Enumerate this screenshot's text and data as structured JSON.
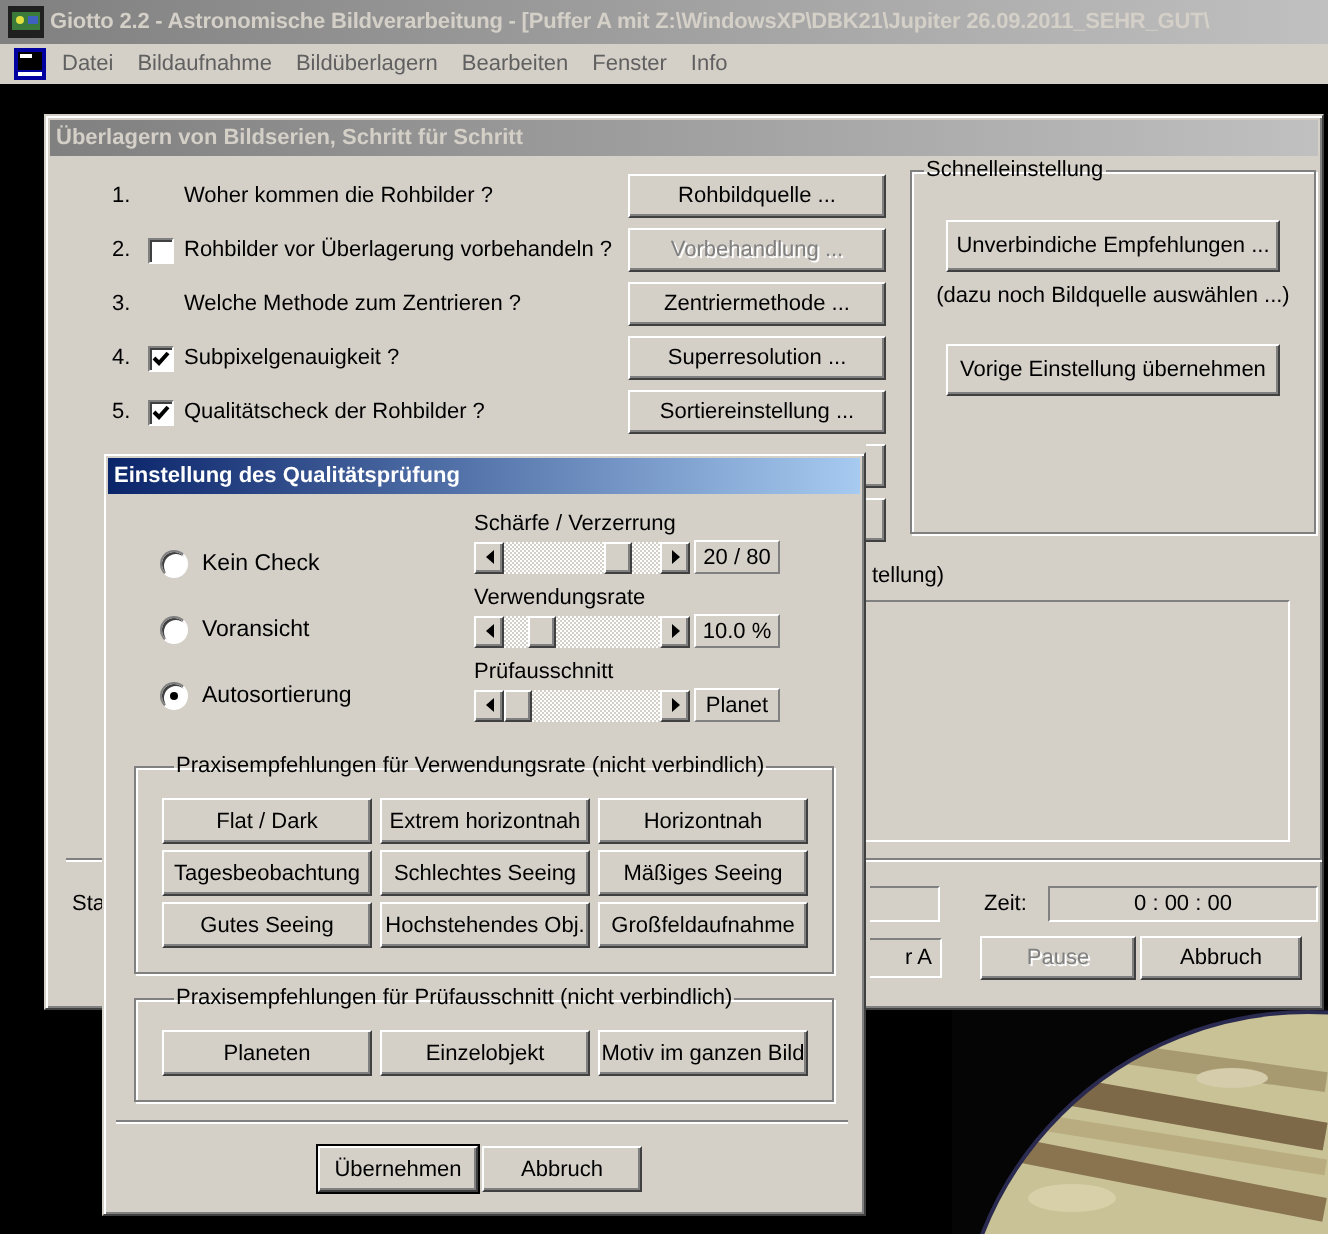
{
  "window": {
    "title": "Giotto 2.2 - Astronomische Bildverarbeitung - [Puffer A mit Z:\\WindowsXP\\DBK21\\Jupiter 26.09.2011_SEHR_GUT\\",
    "menu": [
      "Datei",
      "Bildaufnahme",
      "Bildüberlagern",
      "Bearbeiten",
      "Fenster",
      "Info"
    ]
  },
  "main_dialog": {
    "title": "Überlagern von Bildserien, Schritt für Schritt",
    "steps": [
      {
        "number": "1.",
        "kind": "text",
        "label": "Woher kommen die Rohbilder ?",
        "button": {
          "label": "Rohbildquelle ...",
          "disabled": false
        }
      },
      {
        "number": "2.",
        "kind": "checkbox",
        "checked": false,
        "label": "Rohbilder vor Überlagerung vorbehandeln ?",
        "button": {
          "label": "Vorbehandlung ...",
          "disabled": true
        }
      },
      {
        "number": "3.",
        "kind": "text",
        "label": "Welche Methode zum Zentrieren ?",
        "button": {
          "label": "Zentriermethode ...",
          "disabled": false
        }
      },
      {
        "number": "4.",
        "kind": "checkbox",
        "checked": true,
        "label": "Subpixelgenauigkeit ?",
        "button": {
          "label": "Superresolution ...",
          "disabled": false
        }
      },
      {
        "number": "5.",
        "kind": "checkbox",
        "checked": true,
        "label": "Qualitätscheck der Rohbilder ?",
        "button": {
          "label": "Sortiereinstellung ...",
          "disabled": false
        }
      }
    ],
    "quick_settings": {
      "title": "Schnelleinstellung",
      "recommend_button": "Unverbindiche Empfehlungen ...",
      "hint": "(dazu noch Bildquelle auswählen ...)",
      "previous_button": "Vorige Einstellung übernehmen"
    },
    "log_label": "tellung)",
    "status_label": "Sta",
    "time_label": "Zeit:",
    "time": "0 : 00 : 00",
    "buffer_field": "r A",
    "buttons": [
      {
        "label": "Pause",
        "disabled": true
      },
      {
        "label": "Abbruch",
        "disabled": false
      }
    ]
  },
  "quality_dialog": {
    "title": "Einstellung des Qualitätsprüfung",
    "modes": [
      {
        "label": "Kein Check",
        "selected": false
      },
      {
        "label": "Voransicht",
        "selected": false
      },
      {
        "label": "Autosortierung",
        "selected": true
      }
    ],
    "sliders": [
      {
        "label": "Schärfe / Verzerrung",
        "level": 0.78,
        "reading": "20 / 80"
      },
      {
        "label": "Verwendungsrate",
        "level": 0.18,
        "reading": "10.0 %"
      },
      {
        "label": "Prüfausschnitt",
        "level": 0,
        "reading": "Planet"
      }
    ],
    "groups": [
      {
        "title": "Praxisempfehlungen für Verwendungsrate (nicht verbindlich)",
        "buttons": [
          "Flat / Dark",
          "Extrem horizontnah",
          "Horizontnah",
          "Tagesbeobachtung",
          "Schlechtes Seeing",
          "Mäßiges Seeing",
          "Gutes Seeing",
          "Hochstehendes Obj.",
          "Großfeldaufnahme"
        ]
      },
      {
        "title": "Praxisempfehlungen für Prüfausschnitt (nicht verbindlich)",
        "buttons": [
          "Planeten",
          "Einzelobjekt",
          "Motiv im ganzen Bild"
        ]
      }
    ],
    "footer_buttons": [
      {
        "label": "Übernehmen",
        "default": true
      },
      {
        "label": "Abbruch",
        "default": false
      }
    ]
  }
}
